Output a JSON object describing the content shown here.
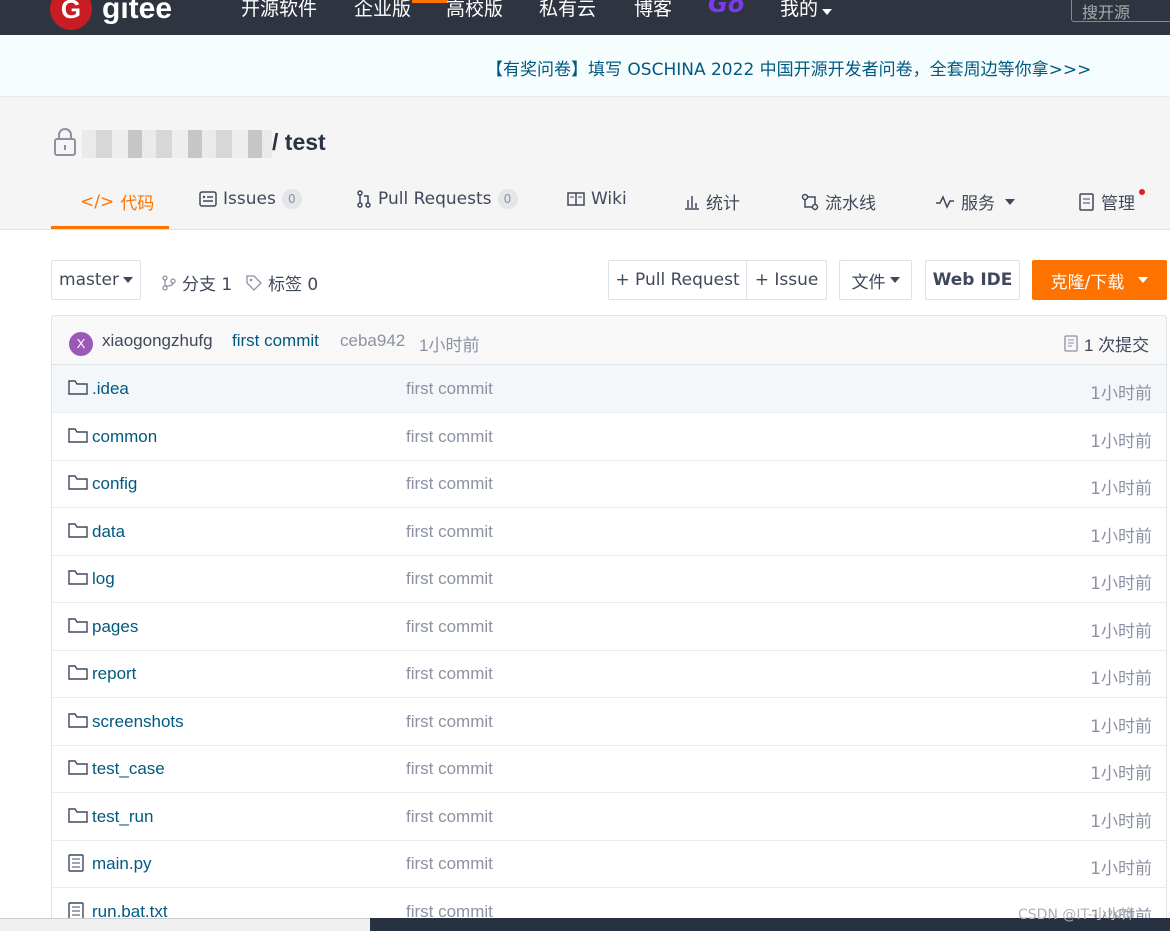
{
  "nav": {
    "logo_mark": "G",
    "logo_text": "gitee",
    "items": [
      "开源软件",
      "企业版",
      "高校版",
      "私有云",
      "博客",
      "Go",
      "我的"
    ],
    "search_placeholder": "搜开源"
  },
  "banner": {
    "text": "【有奖问卷】填写 OSCHINA 2022 中国开源开发者问卷，全套周边等你拿>>>"
  },
  "repo": {
    "name": "/ test"
  },
  "tabs": [
    {
      "label": "代码",
      "icon": "code-icon"
    },
    {
      "label": "Issues",
      "count": "0",
      "icon": "issues-icon"
    },
    {
      "label": "Pull Requests",
      "count": "0",
      "icon": "pull-request-icon"
    },
    {
      "label": "Wiki",
      "icon": "wiki-icon"
    },
    {
      "label": "统计",
      "icon": "stats-icon"
    },
    {
      "label": "流水线",
      "icon": "pipeline-icon"
    },
    {
      "label": "服务",
      "icon": "service-icon"
    },
    {
      "label": "管理",
      "icon": "manage-icon"
    }
  ],
  "toolbar": {
    "branch": "master",
    "branches_label": "分支 1",
    "tags_label": "标签 0",
    "pull_request_button": "+ Pull Request",
    "issue_button": "+ Issue",
    "file_button": "文件",
    "webide_button": "Web IDE",
    "clone_button": "克隆/下载"
  },
  "last_commit": {
    "avatar_letter": "X",
    "author": "xiaogongzhufg",
    "message": "first commit",
    "hash": "ceba942",
    "time": "1小时前",
    "commits_label": "1 次提交"
  },
  "files": [
    {
      "name": ".idea",
      "type": "folder",
      "message": "first commit",
      "time": "1小时前"
    },
    {
      "name": "common",
      "type": "folder",
      "message": "first commit",
      "time": "1小时前"
    },
    {
      "name": "config",
      "type": "folder",
      "message": "first commit",
      "time": "1小时前"
    },
    {
      "name": "data",
      "type": "folder",
      "message": "first commit",
      "time": "1小时前"
    },
    {
      "name": "log",
      "type": "folder",
      "message": "first commit",
      "time": "1小时前"
    },
    {
      "name": "pages",
      "type": "folder",
      "message": "first commit",
      "time": "1小时前"
    },
    {
      "name": "report",
      "type": "folder",
      "message": "first commit",
      "time": "1小时前"
    },
    {
      "name": "screenshots",
      "type": "folder",
      "message": "first commit",
      "time": "1小时前"
    },
    {
      "name": "test_case",
      "type": "folder",
      "message": "first commit",
      "time": "1小时前"
    },
    {
      "name": "test_run",
      "type": "folder",
      "message": "first commit",
      "time": "1小时前"
    },
    {
      "name": "main.py",
      "type": "file",
      "message": "first commit",
      "time": "1小时前"
    },
    {
      "name": "run.bat.txt",
      "type": "file",
      "message": "first commit",
      "time": "1小时前"
    }
  ],
  "watermark": "CSDN @IT-小水饰",
  "colors": {
    "accent": "#fe7300",
    "nav_bg": "#2e3440",
    "link": "#005980",
    "go": "#7c3aed"
  }
}
